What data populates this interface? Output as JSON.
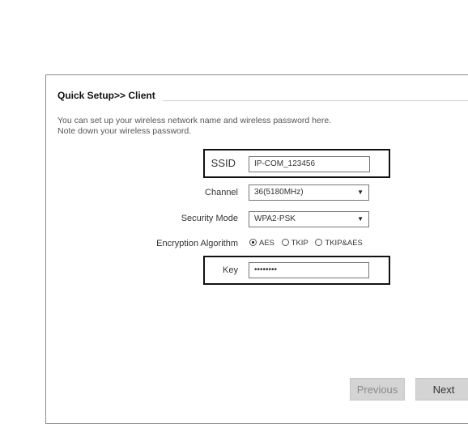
{
  "panel": {
    "title": "Quick Setup>> Client",
    "description": [
      "You can set up your wireless network name and wireless password here.",
      "Note down your wireless password."
    ]
  },
  "form": {
    "ssid_label": "SSID",
    "ssid_value": "IP-COM_123456",
    "channel_label": "Channel",
    "channel_value": "36(5180MHz)",
    "security_label": "Security Mode",
    "security_value": "WPA2-PSK",
    "encryption_label": "Encryption Algorithm",
    "encryption_options": [
      "AES",
      "TKIP",
      "TKIP&AES"
    ],
    "encryption_selected": "AES",
    "key_label": "Key",
    "key_value": "••••••••"
  },
  "buttons": {
    "previous": "Previous",
    "next": "Next"
  },
  "icons": {
    "dropdown": "chevron-down-icon",
    "radio": "radio-icon"
  }
}
